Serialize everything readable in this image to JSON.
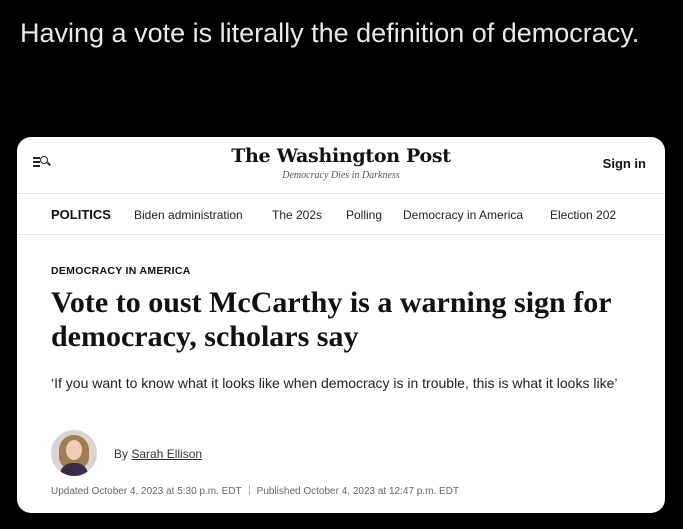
{
  "tweet": {
    "text": "Having a vote is literally the definition of democracy."
  },
  "site": {
    "logo": "The Washington Post",
    "tagline": "Democracy Dies in Darkness",
    "sign_in": "Sign in",
    "icons": [
      "menu-icon",
      "search-icon"
    ]
  },
  "nav": {
    "section": "POLITICS",
    "items": [
      "Biden administration",
      "The 202s",
      "Polling",
      "Democracy in America",
      "Election 202"
    ]
  },
  "article": {
    "kicker": "DEMOCRACY IN AMERICA",
    "headline": "Vote to oust McCarthy is a warning sign for democracy, scholars say",
    "subhead": "‘If you want to know what it looks like when democracy is in trouble, this is what it looks like’",
    "byline_prefix": "By",
    "author": "Sarah Ellison",
    "updated": "Updated October 4, 2023 at 5:30 p.m. EDT",
    "published": "Published October 4, 2023 at 12:47 p.m. EDT"
  }
}
